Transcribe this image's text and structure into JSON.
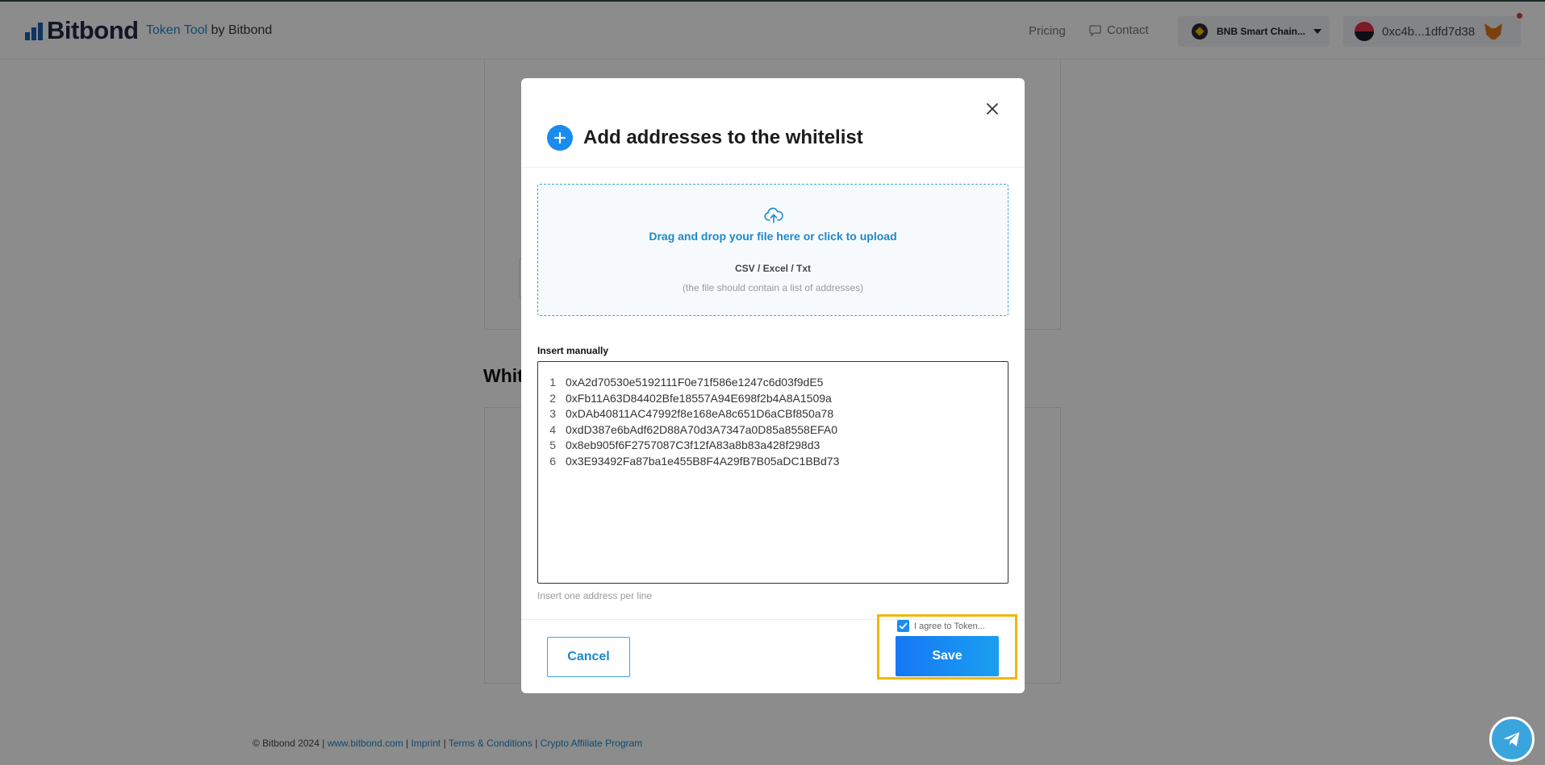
{
  "header": {
    "logo": "Bitbond",
    "product_highlight": "Token Tool",
    "product_suffix": " by Bitbond",
    "nav_pricing": "Pricing",
    "nav_contact": "Contact",
    "chain_label": "BNB Smart Chain...",
    "wallet_address": "0xc4b...1dfd7d38"
  },
  "page": {
    "section_heading": "Whit"
  },
  "modal": {
    "title": "Add addresses to the whitelist",
    "dropzone": {
      "main_text": "Drag and drop your file here or click to upload",
      "file_types": "CSV / Excel / Txt",
      "hint": "(the file should contain a list of addresses)"
    },
    "insert_label": "Insert manually",
    "addresses": [
      {
        "n": "1",
        "value": "0xA2d70530e5192111F0e71f586e1247c6d03f9dE5"
      },
      {
        "n": "2",
        "value": "0xFb11A63D84402Bfe18557A94E698f2b4A8A1509a"
      },
      {
        "n": "3",
        "value": "0xDAb40811AC47992f8e168eA8c651D6aCBf850a78"
      },
      {
        "n": "4",
        "value": "0xdD387e6bAdf62D88A70d3A7347a0D85a8558EFA0"
      },
      {
        "n": "5",
        "value": "0x8eb905f6F2757087C3f12fA83a8b83a428f298d3"
      },
      {
        "n": "6",
        "value": "0x3E93492Fa87ba1e455B8F4A29fB7B05aDC1BBd73"
      }
    ],
    "address_hint": "Insert one address per line",
    "agree_label": "I agree to Token...",
    "agree_checked": true,
    "cancel_label": "Cancel",
    "save_label": "Save"
  },
  "footer": {
    "copyright": "© Bitbond 2024 | ",
    "link_site": "www.bitbond.com",
    "sep1": " | ",
    "link_imprint": "Imprint",
    "sep2": " | ",
    "link_terms": "Terms & Conditions",
    "sep3": " | ",
    "link_affiliate": "Crypto Affiliate Program"
  },
  "colors": {
    "accent": "#1a8cf0",
    "link": "#1e88c9",
    "highlight": "#f2b705"
  },
  "icons": {
    "close": "close-icon",
    "add": "plus-icon",
    "upload": "cloud-upload-icon",
    "contact": "chat-bubble-icon",
    "telegram": "telegram-icon"
  }
}
